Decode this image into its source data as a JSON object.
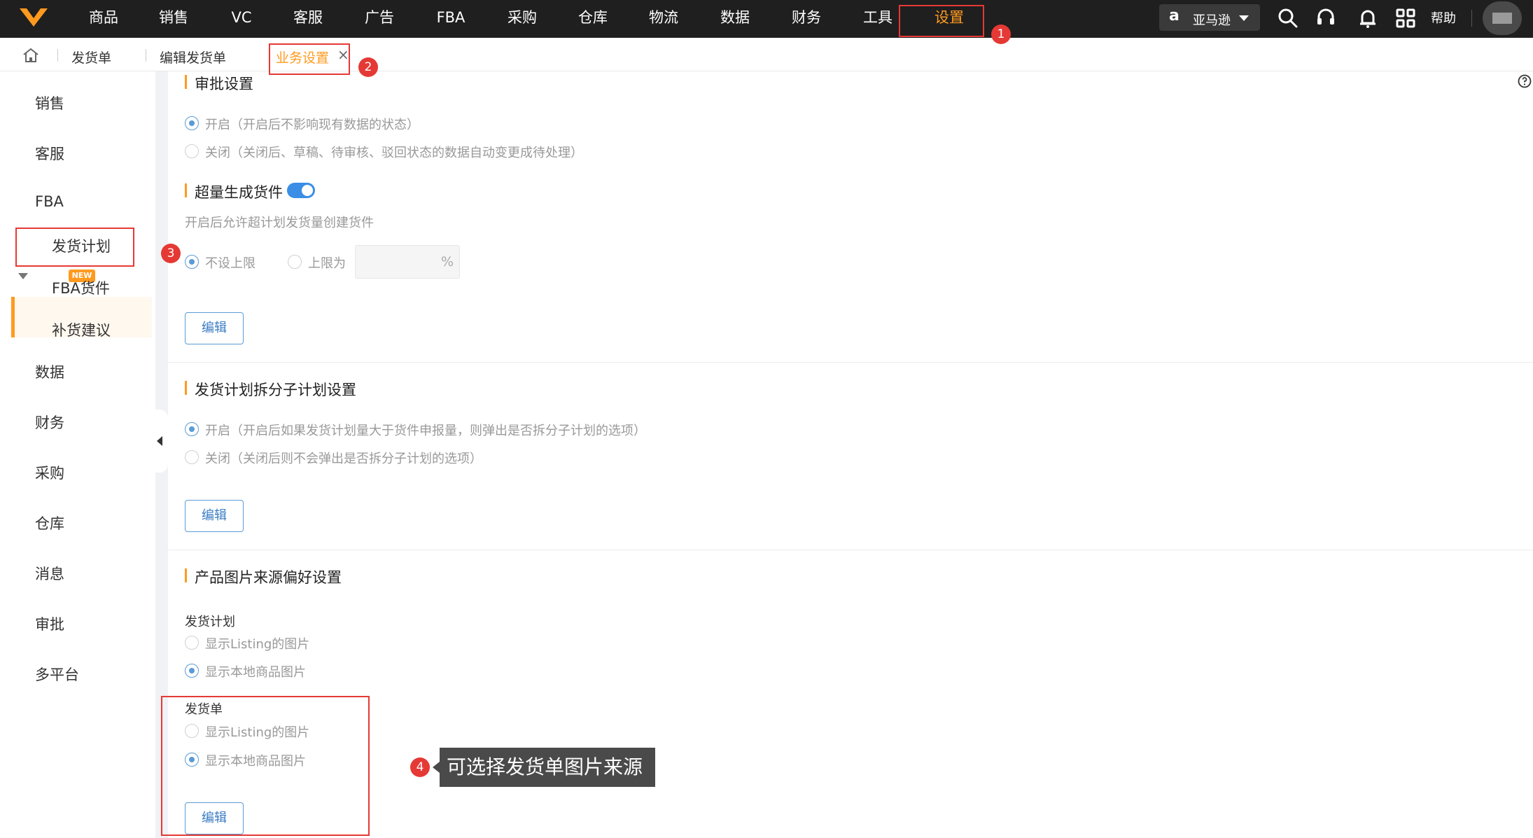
{
  "nav": {
    "items": [
      "商品",
      "销售",
      "VC",
      "客服",
      "广告",
      "FBA",
      "采购",
      "仓库",
      "物流",
      "数据",
      "财务",
      "工具",
      "设置"
    ],
    "active": "设置",
    "store_logo": "a",
    "store": "亚马逊",
    "help": "帮助"
  },
  "tabs": {
    "items": [
      "发货单",
      "编辑发货单",
      "业务设置"
    ],
    "active": "业务设置",
    "close": "×"
  },
  "sidebar": {
    "items": [
      "销售",
      "客服",
      "FBA",
      "数据",
      "财务",
      "采购",
      "仓库",
      "消息",
      "审批",
      "多平台"
    ],
    "fba_badge": "NEW",
    "fba_children": [
      "发货计划",
      "FBA货件",
      "补货建议"
    ],
    "active": "发货计划"
  },
  "approval": {
    "title": "审批设置",
    "options": [
      "开启（开启后不影响现有数据的状态）",
      "关闭（关闭后、草稿、待审核、驳回状态的数据自动变更成待处理）"
    ],
    "selected": 0
  },
  "overgen": {
    "title": "超量生成货件",
    "toggle_on": true,
    "desc": "开启后允许超计划发货量创建货件",
    "options": [
      "不设上限",
      "上限为"
    ],
    "selected": 0,
    "unit": "%",
    "edit": "编辑"
  },
  "split": {
    "title": "发货计划拆分子计划设置",
    "options": [
      "开启（开启后如果发货计划量大于货件申报量，则弹出是否拆分子计划的选项）",
      "关闭（关闭后则不会弹出是否拆分子计划的选项）"
    ],
    "selected": 0,
    "edit": "编辑"
  },
  "image_pref": {
    "title": "产品图片来源偏好设置",
    "plan_label": "发货计划",
    "plan_options": [
      "显示Listing的图片",
      "显示本地商品图片"
    ],
    "plan_selected": 1,
    "shipment_label": "发货单",
    "shipment_options": [
      "显示Listing的图片",
      "显示本地商品图片"
    ],
    "shipment_selected": 1,
    "edit": "编辑"
  },
  "annotations": {
    "badges": [
      "1",
      "2",
      "3",
      "4"
    ],
    "tooltip": "可选择发货单图片来源"
  },
  "colors": {
    "accent": "#ff9a1f",
    "topbar": "#1f1f1f",
    "primary": "#3a8ee6",
    "annotation": "#e53935"
  }
}
